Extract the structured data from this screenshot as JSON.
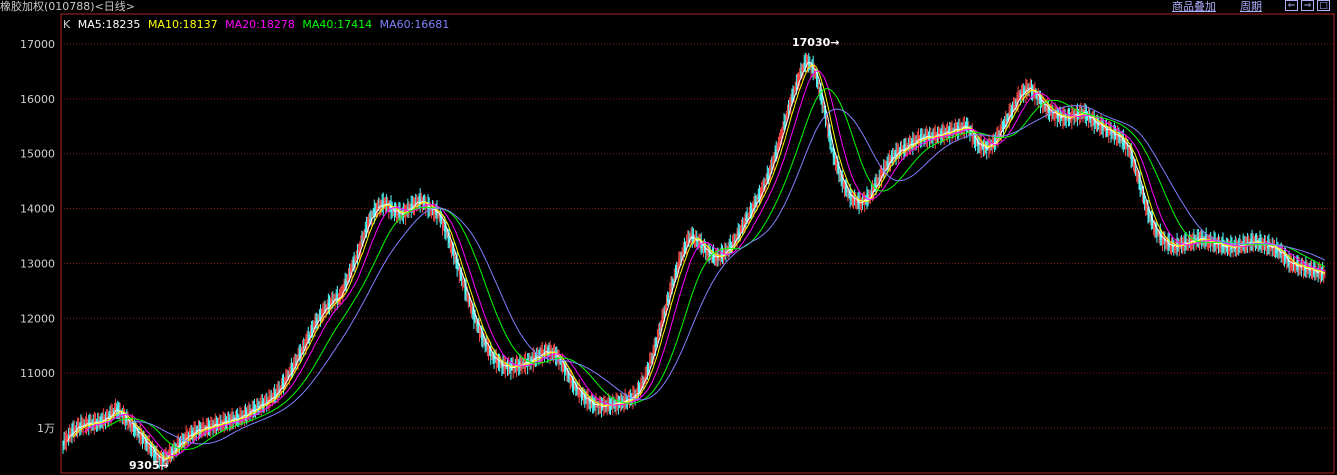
{
  "header": {
    "title": "橡胶加权(010788)<日线>",
    "menu_overlay": "商品叠加",
    "menu_period": "周期",
    "btn_prev": "⇐",
    "btn_next": "⇒",
    "btn_view": "□"
  },
  "legend": {
    "k": "K",
    "ma5": "MA5:18235",
    "ma10": "MA10:18137",
    "ma20": "MA20:18278",
    "ma40": "MA40:17414",
    "ma60": "MA60:16681"
  },
  "chart_data": {
    "type": "line",
    "instrument": "橡胶加权(010788)",
    "period": "日线",
    "y_tick_labels": [
      "17000",
      "16000",
      "15000",
      "14000",
      "13000",
      "12000",
      "11000",
      "1万"
    ],
    "y_ticks": [
      17000,
      16000,
      15000,
      14000,
      13000,
      12000,
      11000,
      10000
    ],
    "ylim": [
      9200,
      17500
    ],
    "grid": true,
    "annotations": [
      {
        "label": "17030",
        "value": 17030
      },
      {
        "label": "9305",
        "value": 9305
      }
    ],
    "ma_values": {
      "MA5": 18235,
      "MA10": 18137,
      "MA20": 18278,
      "MA40": 17414,
      "MA60": 16681
    },
    "colors": {
      "up": "#ff4c4c",
      "down": "#54ffff",
      "ma5": "#ffffff",
      "ma10": "#ffff00",
      "ma20": "#ff00ff",
      "ma40": "#00ff00",
      "ma60": "#8080ff",
      "grid": "#8b1a1a",
      "border": "#b22222"
    },
    "close_series": [
      9700,
      9920,
      10040,
      10080,
      10100,
      10180,
      10350,
      10180,
      10000,
      9800,
      9600,
      9400,
      9520,
      9700,
      9850,
      9950,
      10000,
      10050,
      10100,
      10150,
      10200,
      10300,
      10400,
      10500,
      10650,
      10900,
      11200,
      11500,
      11850,
      12100,
      12300,
      12400,
      12800,
      13200,
      13700,
      14000,
      14100,
      13950,
      13900,
      14050,
      14150,
      14000,
      13900,
      13500,
      13000,
      12500,
      12000,
      11600,
      11300,
      11150,
      11100,
      11150,
      11200,
      11300,
      11400,
      11350,
      11100,
      10800,
      10600,
      10450,
      10400,
      10420,
      10450,
      10500,
      10600,
      10900,
      11400,
      12000,
      12600,
      13100,
      13500,
      13400,
      13200,
      13100,
      13200,
      13400,
      13700,
      14000,
      14300,
      14700,
      15200,
      15800,
      16300,
      16700,
      16500,
      15800,
      15000,
      14500,
      14200,
      14100,
      14200,
      14500,
      14800,
      15000,
      15100,
      15200,
      15300,
      15300,
      15350,
      15400,
      15450,
      15500,
      15200,
      15100,
      15200,
      15500,
      15800,
      16100,
      16200,
      16000,
      15800,
      15700,
      15650,
      15700,
      15750,
      15600,
      15500,
      15400,
      15300,
      15100,
      14600,
      14000,
      13600,
      13400,
      13300,
      13350,
      13400,
      13450,
      13400,
      13350,
      13300,
      13300,
      13350,
      13400,
      13350,
      13300,
      13200,
      13000,
      12950,
      12900,
      12850,
      12800
    ]
  }
}
